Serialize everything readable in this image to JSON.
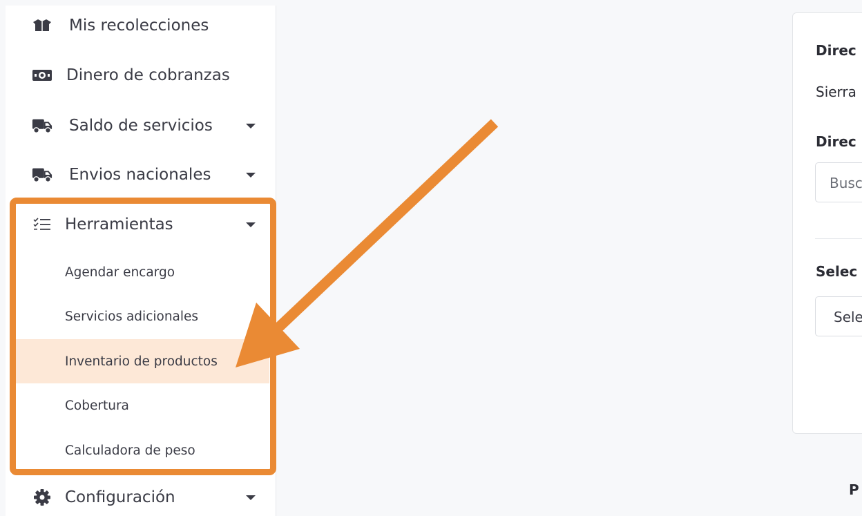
{
  "sidebar": {
    "items": [
      {
        "label": "Mis recolecciones",
        "icon": "box-icon"
      },
      {
        "label": "Dinero de cobranzas",
        "icon": "money-bill-icon"
      },
      {
        "label": "Saldo de servicios",
        "icon": "truck-icon"
      },
      {
        "label": "Envios nacionales",
        "icon": "truck-icon"
      },
      {
        "label": "Herramientas",
        "icon": "tasks-list-icon"
      },
      {
        "label": "Configuración",
        "icon": "gear-icon"
      }
    ],
    "subitems": [
      {
        "label": "Agendar encargo"
      },
      {
        "label": "Servicios adicionales"
      },
      {
        "label": "Inventario de productos",
        "active": true
      },
      {
        "label": "Cobertura"
      },
      {
        "label": "Calculadora de peso"
      }
    ]
  },
  "card": {
    "heading1": "Direc",
    "value1": "Sierra",
    "heading2": "Direc",
    "search_placeholder": "Busc",
    "heading3": "Selec",
    "select_value": "Sele"
  },
  "footer": {
    "text": "P"
  },
  "colors": {
    "accent": "#ea8a34",
    "active_bg": "#fde8d7",
    "text": "#3a3b45"
  }
}
